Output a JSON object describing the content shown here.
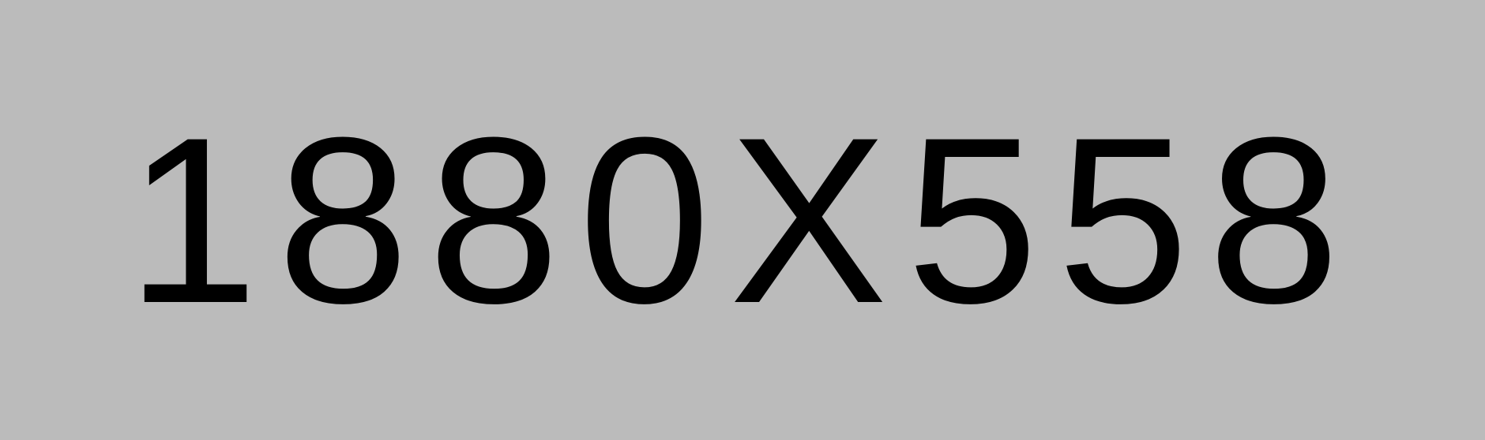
{
  "placeholder": {
    "text": "1880X558",
    "background_color": "#bbbbbb",
    "text_color": "#000000"
  }
}
